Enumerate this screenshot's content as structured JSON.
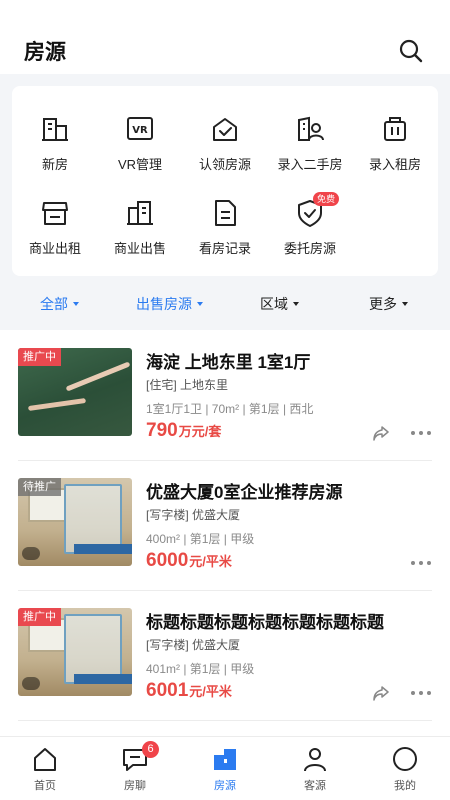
{
  "header": {
    "title": "房源"
  },
  "grid": {
    "items": [
      {
        "label": "新房",
        "icon": "building-icon"
      },
      {
        "label": "VR管理",
        "icon": "vr-icon"
      },
      {
        "label": "认领房源",
        "icon": "claim-house-icon"
      },
      {
        "label": "录入二手房",
        "icon": "secondhand-house-icon"
      },
      {
        "label": "录入租房",
        "icon": "rental-icon"
      },
      {
        "label": "商业出租",
        "icon": "shop-icon"
      },
      {
        "label": "商业出售",
        "icon": "commercial-building-icon"
      },
      {
        "label": "看房记录",
        "icon": "document-icon"
      },
      {
        "label": "委托房源",
        "icon": "shield-check-icon"
      }
    ],
    "free_badge": "免费"
  },
  "filters": [
    {
      "label": "全部",
      "color": "#2b7bf0"
    },
    {
      "label": "出售房源",
      "color": "#2b7bf0"
    },
    {
      "label": "区域",
      "color": "#222222"
    },
    {
      "label": "更多",
      "color": "#222222"
    }
  ],
  "listings": [
    {
      "tag": "推广中",
      "title": "海淀 上地东里 1室1厅",
      "type": "[住宅] 上地东里",
      "info": "1室1厅1卫 | 70m² | 第1层 | 西北",
      "price": "790",
      "unit": "万元/套"
    },
    {
      "tag": "待推广",
      "title": "优盛大厦0室企业推荐房源",
      "type": "[写字楼] 优盛大厦",
      "info": "400m² | 第1层 | 甲级",
      "price": "6000",
      "unit": "元/平米"
    },
    {
      "tag": "推广中",
      "title": "标题标题标题标题标题标题标题",
      "type": "[写字楼] 优盛大厦",
      "info": "401m² | 第1层 | 甲级",
      "price": "6001",
      "unit": "元/平米"
    }
  ],
  "tabbar": {
    "items": [
      {
        "label": "首页",
        "icon": "home-icon"
      },
      {
        "label": "房聊",
        "icon": "chat-icon",
        "badge": "6"
      },
      {
        "label": "房源",
        "icon": "house-listing-icon",
        "active": true
      },
      {
        "label": "客源",
        "icon": "person-icon"
      },
      {
        "label": "我的",
        "icon": "profile-circle-icon"
      }
    ]
  },
  "colors": {
    "accent": "#2b7bf0",
    "price": "#e84a45",
    "tag_red": "#e9494f",
    "badge": "#f0444a"
  }
}
